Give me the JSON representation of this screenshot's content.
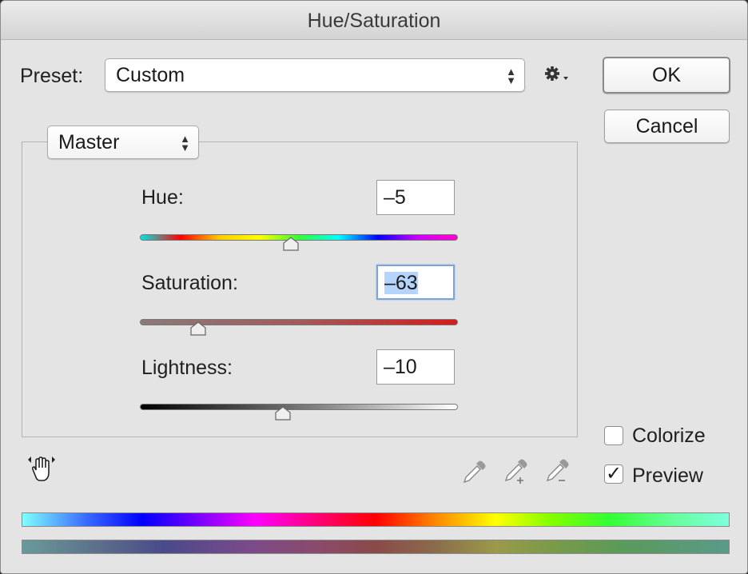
{
  "window": {
    "title": "Hue/Saturation"
  },
  "preset": {
    "label": "Preset:",
    "value": "Custom"
  },
  "buttons": {
    "ok": "OK",
    "cancel": "Cancel"
  },
  "channel": {
    "value": "Master"
  },
  "sliders": {
    "hue": {
      "label": "Hue:",
      "value": "–5"
    },
    "saturation": {
      "label": "Saturation:",
      "value": "–63"
    },
    "lightness": {
      "label": "Lightness:",
      "value": "–10"
    }
  },
  "options": {
    "colorize": {
      "label": "Colorize",
      "checked": false
    },
    "preview": {
      "label": "Preview",
      "checked": true,
      "mark": "✓"
    }
  },
  "icons": {
    "settings": "gear-icon",
    "targeted_adjustment": "hand-icon",
    "eyedroppers": [
      "eyedropper-icon",
      "eyedropper-add-icon",
      "eyedropper-subtract-icon"
    ]
  },
  "colors": {
    "focus_ring": "#7ca4d8",
    "selection": "#b5d4fb"
  }
}
